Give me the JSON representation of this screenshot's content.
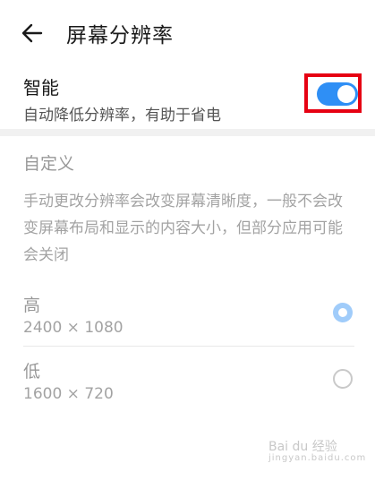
{
  "header": {
    "title": "屏幕分辨率",
    "back_icon": "arrow-left-icon"
  },
  "smart": {
    "title": "智能",
    "subtitle": "自动降低分辨率，有助于省电",
    "toggle_on": true,
    "accent_color": "#2f8ff5",
    "highlight_color": "#e60012"
  },
  "custom": {
    "section_title": "自定义",
    "description": "手动更改分辨率会改变屏幕清晰度，一般不会改变屏幕布局和显示的内容大小，但部分应用可能会关闭",
    "options": [
      {
        "label": "高",
        "value": "2400 × 1080",
        "selected": true
      },
      {
        "label": "低",
        "value": "1600 × 720",
        "selected": false
      }
    ]
  },
  "watermark": {
    "text": "Bai du 经验",
    "sub": "jingyan.baidu.com"
  }
}
